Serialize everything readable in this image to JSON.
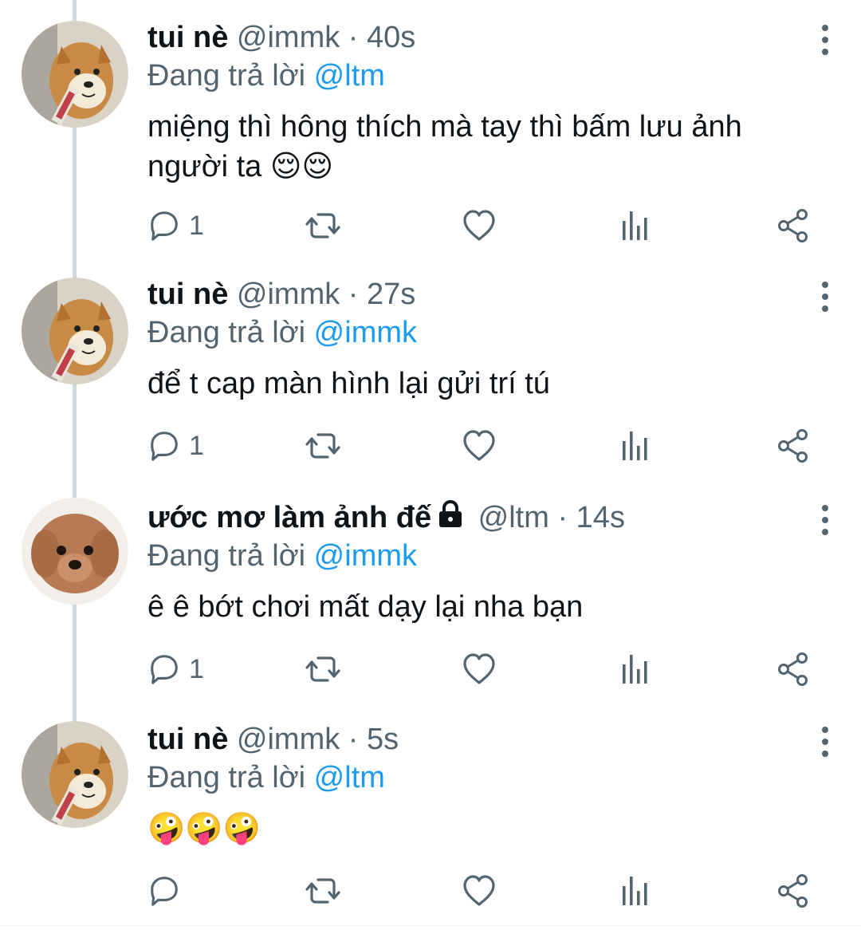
{
  "colors": {
    "mention": "#1d9bf0",
    "muted": "#536471",
    "text": "#0f1419",
    "thread_line": "#cfd9de"
  },
  "tweets": [
    {
      "name": "tui nè",
      "handle": "@immk",
      "dot": "·",
      "time": "40s",
      "locked": false,
      "reply_prefix": "Đang trả lời",
      "reply_to": "@ltm",
      "text": "miệng thì hông thích mà tay thì bấm lưu ảnh người ta 😌😌",
      "reply_count": "1",
      "avatar": "shiba-dog"
    },
    {
      "name": "tui nè",
      "handle": "@immk",
      "dot": "·",
      "time": "27s",
      "locked": false,
      "reply_prefix": "Đang trả lời",
      "reply_to": "@immk",
      "text": "để t cap màn hình lại gửi trí tú",
      "reply_count": "1",
      "avatar": "shiba-dog"
    },
    {
      "name": "ước mơ làm ảnh đế",
      "handle": "@ltm",
      "dot": "·",
      "time": "14s",
      "locked": true,
      "reply_prefix": "Đang trả lời",
      "reply_to": "@immk",
      "text": "ê ê bớt chơi mất dạy lại nha bạn",
      "reply_count": "1",
      "avatar": "poodle-dog"
    },
    {
      "name": "tui nè",
      "handle": "@immk",
      "dot": "·",
      "time": "5s",
      "locked": false,
      "reply_prefix": "Đang trả lời",
      "reply_to": "@ltm",
      "text": "🤪🤪🤪",
      "reply_count": "",
      "avatar": "shiba-dog"
    }
  ],
  "icons": {
    "reply": "reply-icon",
    "retweet": "retweet-icon",
    "like": "heart-icon",
    "analytics": "analytics-icon",
    "share": "share-icon",
    "more": "more-vertical-icon",
    "lock": "lock-icon"
  }
}
